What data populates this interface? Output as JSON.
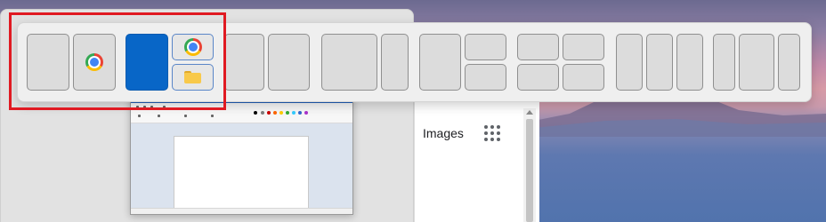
{
  "sidebar_search": {
    "images_label": "Images",
    "apps_icon": "apps-grid-icon"
  },
  "snap_layouts": {
    "layouts": [
      {
        "name": "two-halves",
        "zones": 2
      },
      {
        "name": "main-with-two-stacked",
        "zones": 3
      },
      {
        "name": "two-thirds-split",
        "zones": 2
      },
      {
        "name": "wide-left-narrow-right",
        "zones": 2
      },
      {
        "name": "left-with-two-stacked-right",
        "zones": 3
      },
      {
        "name": "four-quadrants",
        "zones": 4
      },
      {
        "name": "three-columns",
        "zones": 3
      },
      {
        "name": "narrow-wide-narrow",
        "zones": 3
      }
    ],
    "active_layout": "main-with-two-stacked",
    "suggested_apps": [
      "chrome-icon",
      "folder-icon"
    ]
  },
  "colors": {
    "accent": "#0866c7",
    "highlight": "#e01a22",
    "flyout_bg": "#efefef"
  }
}
